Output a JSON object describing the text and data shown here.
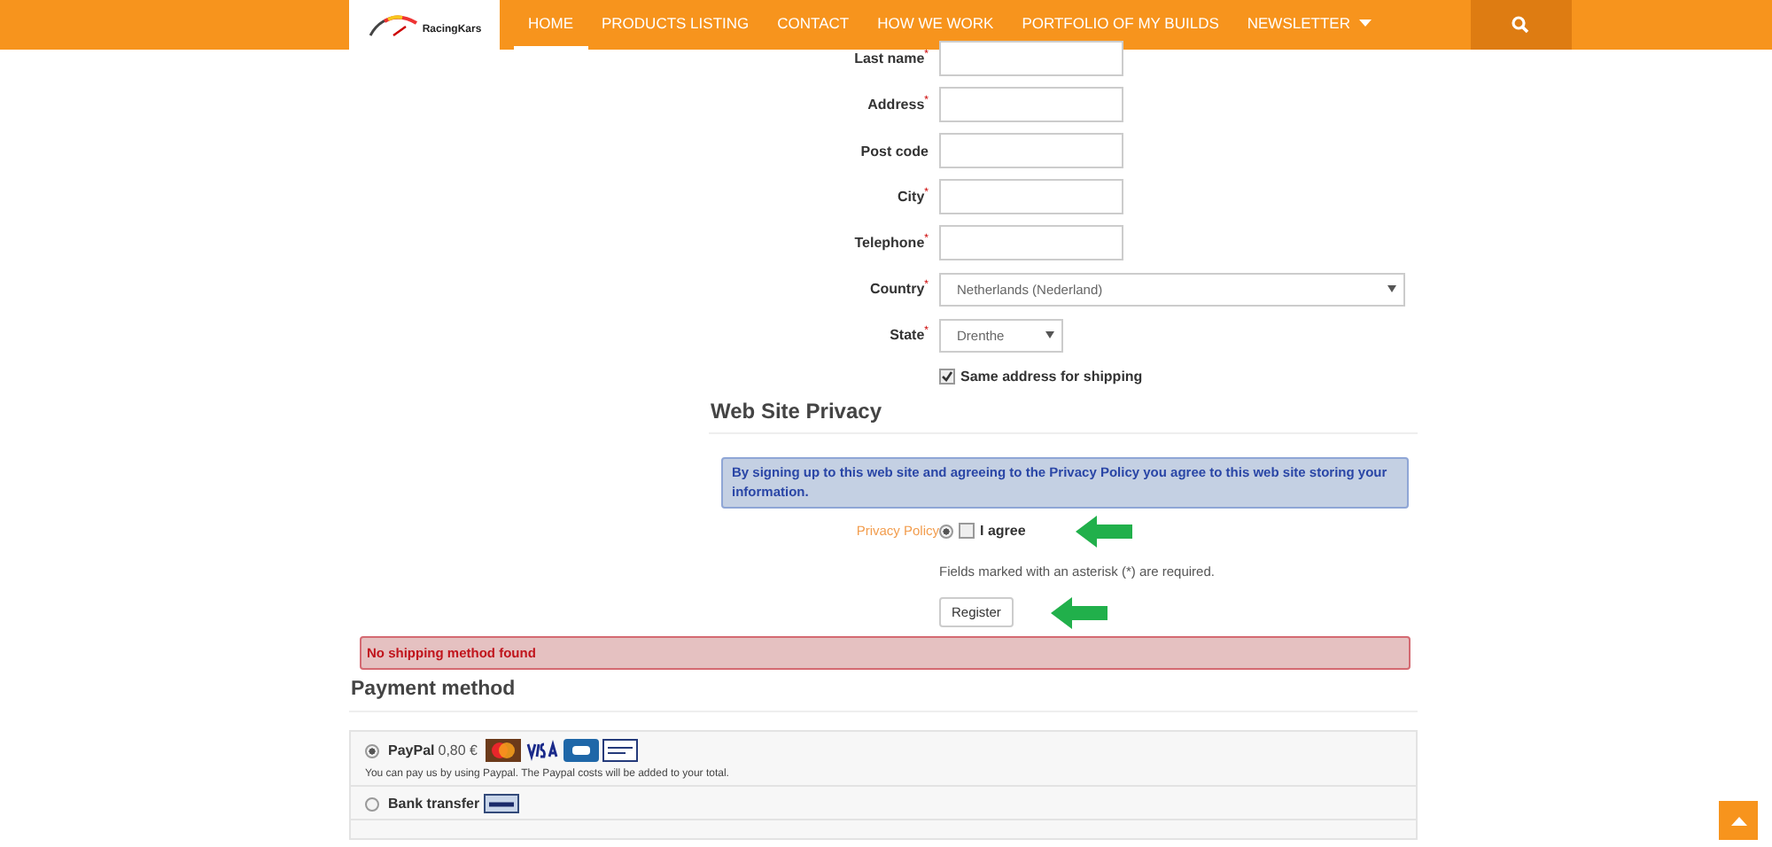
{
  "logo": {
    "text": "RacingKars"
  },
  "nav": [
    {
      "label": "HOME",
      "selected": true,
      "dropdown": false
    },
    {
      "label": "PRODUCTS LISTING",
      "selected": false,
      "dropdown": false
    },
    {
      "label": "CONTACT",
      "selected": false,
      "dropdown": false
    },
    {
      "label": "HOW WE WORK",
      "selected": false,
      "dropdown": false
    },
    {
      "label": "PORTFOLIO OF MY BUILDS",
      "selected": false,
      "dropdown": false
    },
    {
      "label": "NEWSLETTER",
      "selected": false,
      "dropdown": true
    }
  ],
  "fields": [
    {
      "kind": "text",
      "label": "Last name",
      "required_mark": "*"
    },
    {
      "kind": "text",
      "label": "Address",
      "required_mark": "*"
    },
    {
      "kind": "text",
      "label": "Post code"
    },
    {
      "kind": "text",
      "label": "City",
      "required_mark": "*"
    },
    {
      "kind": "text",
      "label": "Telephone",
      "required_mark": "*"
    },
    {
      "kind": "select-wide",
      "label": "Country",
      "required_mark": "*",
      "value": "Netherlands (Nederland)"
    },
    {
      "kind": "select",
      "label": "State",
      "required_mark": "*",
      "value": "Drenthe"
    }
  ],
  "same_address": {
    "label": "Same address for shipping",
    "checked": true
  },
  "privacy": {
    "heading": "Web Site Privacy",
    "notice": "By signing up to this web site and agreeing to the Privacy Policy you agree to this web site storing your information.",
    "policy_label": "Privacy Policy",
    "policy_radio_selected": true,
    "agree_label": "I agree",
    "agree_checked": false,
    "required_note": "Fields marked with an asterisk (*) are required.",
    "register_button": "Register"
  },
  "shipping_alert": "No shipping method found",
  "payment": {
    "heading": "Payment method",
    "methods": [
      {
        "kind": "paypal",
        "name": "PayPal",
        "price": "0,80 €",
        "selected": true,
        "description": "You can pay us by using Paypal. The Paypal costs will be added to your total."
      },
      {
        "kind": "bank",
        "name": "Bank transfer",
        "selected": false
      }
    ]
  }
}
